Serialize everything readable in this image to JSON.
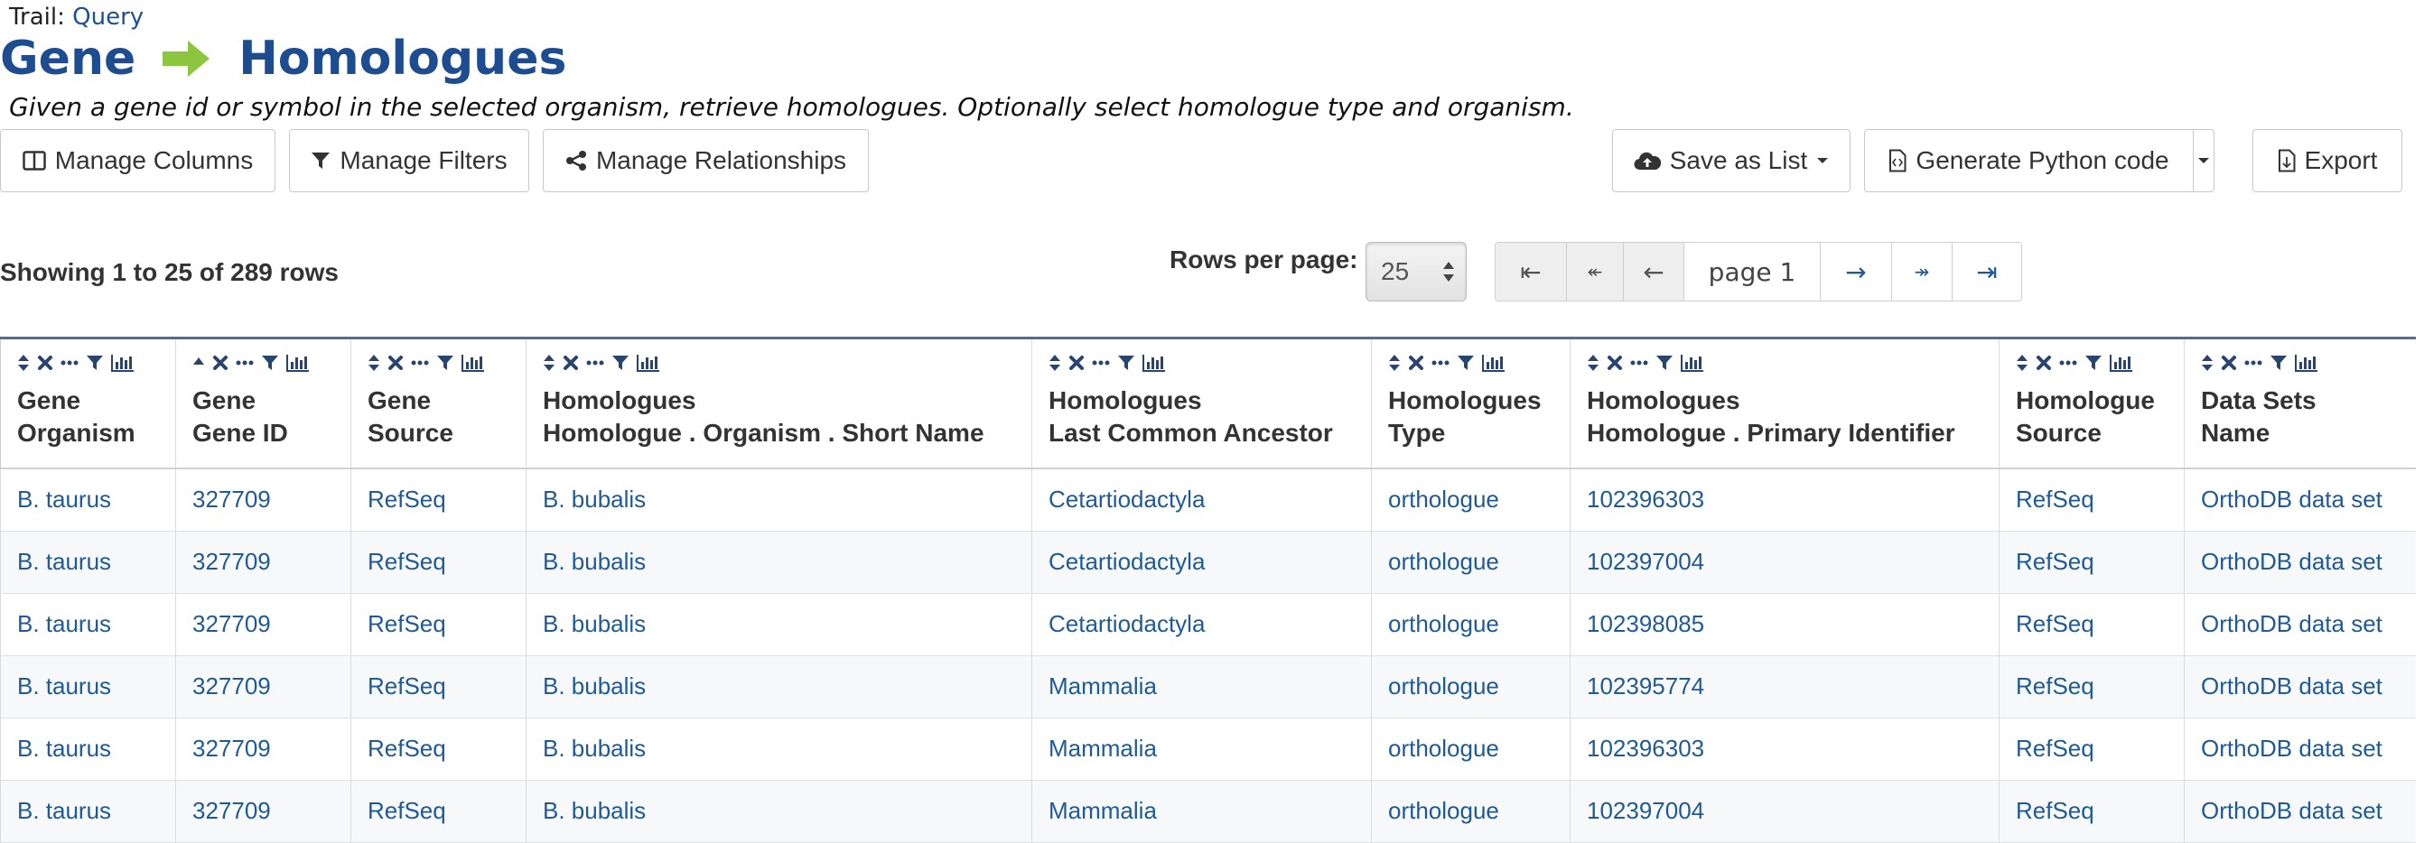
{
  "trail": {
    "label": "Trail:",
    "link": "Query"
  },
  "title": {
    "left": "Gene",
    "right": "Homologues",
    "arrow_icon": "right-arrow-icon",
    "arrow_color": "#8cc63f"
  },
  "description": "Given a gene id or symbol in the selected organism, retrieve homologues. Optionally select homologue type and organism.",
  "toolbar": {
    "manage_columns": "Manage Columns",
    "manage_filters": "Manage Filters",
    "manage_relationships": "Manage Relationships",
    "save_as_list": "Save as List",
    "generate_python": "Generate Python code",
    "export": "Export"
  },
  "paging": {
    "showing": "Showing 1 to 25 of 289 rows",
    "rows_per_page_label": "Rows per page:",
    "rows_per_page_value": "25",
    "page_label": "page 1",
    "first_icon": "⇤",
    "prev_page_icon": "↞",
    "prev_icon": "←",
    "next_icon": "→",
    "next_page_icon": "↠",
    "last_icon": "⇥"
  },
  "columns": [
    {
      "line1": "Gene",
      "line2": "Organism"
    },
    {
      "line1": "Gene",
      "line2": "Gene ID"
    },
    {
      "line1": "Gene",
      "line2": "Source"
    },
    {
      "line1": "Homologues",
      "line2": "Homologue . Organism . Short Name"
    },
    {
      "line1": "Homologues",
      "line2": "Last Common Ancestor"
    },
    {
      "line1": "Homologues",
      "line2": "Type"
    },
    {
      "line1": "Homologues",
      "line2": "Homologue . Primary Identifier"
    },
    {
      "line1": "Homologue",
      "line2": "Source"
    },
    {
      "line1": "Data Sets",
      "line2": "Name"
    }
  ],
  "rows": [
    [
      "B. taurus",
      "327709",
      "RefSeq",
      "B. bubalis",
      "Cetartiodactyla",
      "orthologue",
      "102396303",
      "RefSeq",
      "OrthoDB data set"
    ],
    [
      "B. taurus",
      "327709",
      "RefSeq",
      "B. bubalis",
      "Cetartiodactyla",
      "orthologue",
      "102397004",
      "RefSeq",
      "OrthoDB data set"
    ],
    [
      "B. taurus",
      "327709",
      "RefSeq",
      "B. bubalis",
      "Cetartiodactyla",
      "orthologue",
      "102398085",
      "RefSeq",
      "OrthoDB data set"
    ],
    [
      "B. taurus",
      "327709",
      "RefSeq",
      "B. bubalis",
      "Mammalia",
      "orthologue",
      "102395774",
      "RefSeq",
      "OrthoDB data set"
    ],
    [
      "B. taurus",
      "327709",
      "RefSeq",
      "B. bubalis",
      "Mammalia",
      "orthologue",
      "102396303",
      "RefSeq",
      "OrthoDB data set"
    ],
    [
      "B. taurus",
      "327709",
      "RefSeq",
      "B. bubalis",
      "Mammalia",
      "orthologue",
      "102397004",
      "RefSeq",
      "OrthoDB data set"
    ]
  ],
  "colors": {
    "title": "#1d4c91",
    "link": "#1f5a96",
    "header_border": "#4b6f95"
  }
}
